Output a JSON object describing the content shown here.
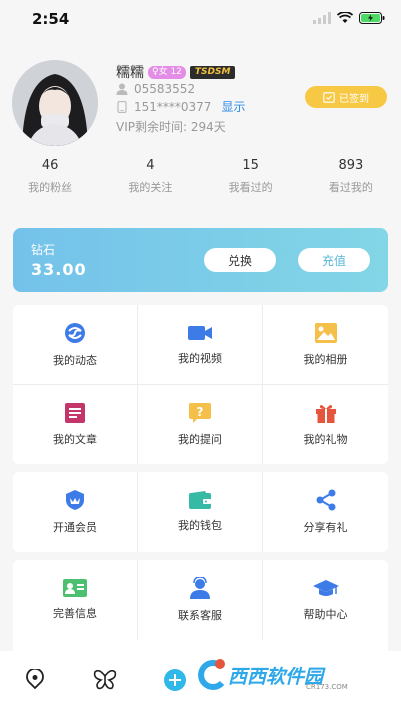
{
  "status_bar": {
    "time": "2:54"
  },
  "profile": {
    "nickname": "糯糯",
    "sex_badge": "♀女 12",
    "tag_badge": "TSDSM",
    "user_id": "05583552",
    "phone": "151****0377",
    "show_label": "显示",
    "vip_text": "VIP剩余时间: 294天",
    "sign_label": "已签到"
  },
  "stats": [
    {
      "num": "46",
      "label": "我的粉丝"
    },
    {
      "num": "4",
      "label": "我的关注"
    },
    {
      "num": "15",
      "label": "我看过的"
    },
    {
      "num": "893",
      "label": "看过我的"
    }
  ],
  "diamond": {
    "title": "钻石",
    "value": "33.00",
    "exchange_label": "兑换",
    "recharge_label": "充值"
  },
  "grid1": [
    {
      "label": "我的动态",
      "icon": "moments-icon"
    },
    {
      "label": "我的视频",
      "icon": "video-icon"
    },
    {
      "label": "我的相册",
      "icon": "album-icon"
    },
    {
      "label": "我的文章",
      "icon": "article-icon"
    },
    {
      "label": "我的提问",
      "icon": "question-icon"
    },
    {
      "label": "我的礼物",
      "icon": "gift-icon"
    }
  ],
  "grid2": [
    {
      "label": "开通会员",
      "icon": "vip-icon"
    },
    {
      "label": "我的钱包",
      "icon": "wallet-icon"
    },
    {
      "label": "分享有礼",
      "icon": "share-icon"
    }
  ],
  "grid3": [
    {
      "label": "完善信息",
      "icon": "profile-card-icon"
    },
    {
      "label": "联系客服",
      "icon": "customer-service-icon"
    },
    {
      "label": "帮助中心",
      "icon": "help-center-icon"
    }
  ],
  "tabbar": {
    "icons": [
      "location-icon",
      "butterfly-icon",
      "add-icon"
    ]
  },
  "watermark": {
    "text": "西西软件园",
    "domain": "CR173.COM"
  },
  "colors": {
    "accent_blue": "#2f8be8",
    "sign_yellow": "#f7c844",
    "diamond_gradient_start": "#74c2ea",
    "diamond_gradient_end": "#82d6e6"
  }
}
